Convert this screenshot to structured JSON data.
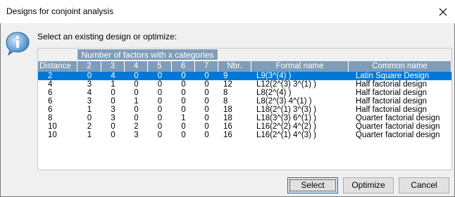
{
  "window": {
    "title": "Designs for conjoint analysis"
  },
  "dialog": {
    "instruction": "Select an existing design or optimize:"
  },
  "table": {
    "group_header": "Number of factors with x categories",
    "columns": [
      "Distance",
      "2",
      "3",
      "4",
      "5",
      "6",
      "7",
      "Nbr. exp.",
      "Formal name",
      "Common name"
    ],
    "rows": [
      [
        "2",
        "0",
        "4",
        "0",
        "0",
        "0",
        "0",
        "9",
        "L9(3^(4) )",
        "Latin Square Design"
      ],
      [
        "4",
        "3",
        "1",
        "0",
        "0",
        "0",
        "0",
        "12",
        "L12(2^(3) 3^(1) )",
        "Half factorial design"
      ],
      [
        "6",
        "4",
        "0",
        "0",
        "0",
        "0",
        "0",
        "8",
        "L8(2^(4) )",
        "Half factorial design"
      ],
      [
        "6",
        "3",
        "0",
        "1",
        "0",
        "0",
        "0",
        "8",
        "L8(2^(3) 4^(1) )",
        "Half factorial design"
      ],
      [
        "6",
        "1",
        "3",
        "0",
        "0",
        "0",
        "0",
        "18",
        "L18(2^(1) 3^(3) )",
        "Half factorial design"
      ],
      [
        "8",
        "0",
        "3",
        "0",
        "0",
        "1",
        "0",
        "18",
        "L18(3^(3) 6^(1) )",
        "Quarter factorial design"
      ],
      [
        "10",
        "2",
        "0",
        "2",
        "0",
        "0",
        "0",
        "16",
        "L16(2^(2) 4^(2) )",
        "Quarter factorial design"
      ],
      [
        "10",
        "1",
        "0",
        "3",
        "0",
        "0",
        "0",
        "16",
        "L16(2^(1) 4^(3) )",
        "Quarter factorial design"
      ]
    ],
    "selected_row": 0
  },
  "buttons": {
    "select": "Select",
    "optimize": "Optimize",
    "cancel": "Cancel"
  },
  "colors": {
    "header_bg": "#7f9db9",
    "selection": "#0078d7",
    "info_icon": "#2a79c6"
  },
  "icons": {
    "close": "close-icon",
    "info": "info-icon"
  }
}
